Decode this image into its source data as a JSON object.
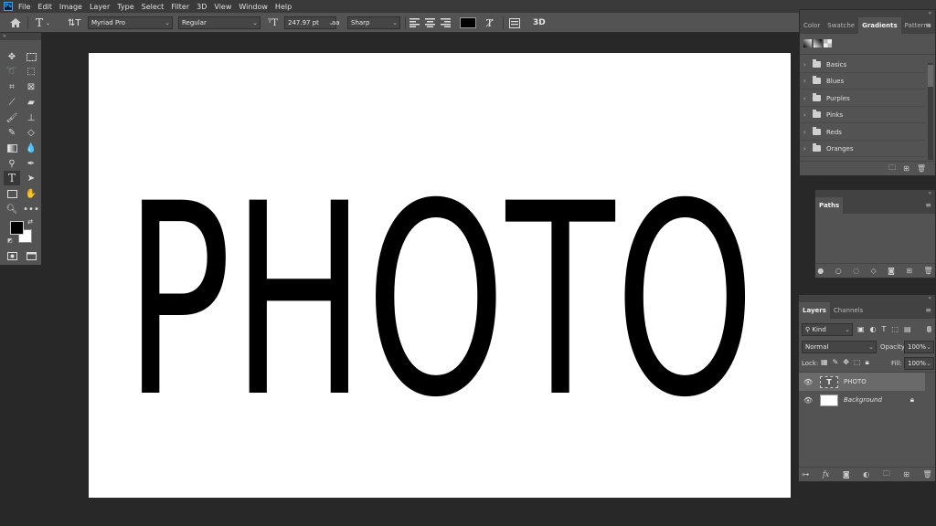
{
  "menubar": {
    "app_badge": "Ps",
    "items": [
      "File",
      "Edit",
      "Image",
      "Layer",
      "Type",
      "Select",
      "Filter",
      "3D",
      "View",
      "Window",
      "Help"
    ]
  },
  "options": {
    "font_family": "Myriad Pro",
    "font_style": "Regular",
    "font_size": "247.97 pt",
    "aa_label": "aa",
    "antialias": "Sharp",
    "threed_label": "3D",
    "text_color": "#000000"
  },
  "canvas": {
    "text": "PHOTO",
    "background": "#ffffff",
    "text_color": "#000000"
  },
  "gradients_panel": {
    "tabs": [
      "Color",
      "Swatche",
      "Gradients",
      "Patterns"
    ],
    "active_tab": "Gradients",
    "folders": [
      "Basics",
      "Blues",
      "Purples",
      "Pinks",
      "Reds",
      "Oranges"
    ]
  },
  "paths_panel": {
    "tab": "Paths"
  },
  "layers_panel": {
    "tabs": [
      "Layers",
      "Channels"
    ],
    "filter_kind": "Kind",
    "blend_mode": "Normal",
    "opacity_label": "Opacity:",
    "opacity_value": "100%",
    "lock_label": "Lock:",
    "fill_label": "Fill:",
    "fill_value": "100%",
    "layers": [
      {
        "name": "PHOTO",
        "type": "text",
        "selected": true
      },
      {
        "name": "Background",
        "type": "image",
        "selected": false
      }
    ],
    "footer_fx": "fx"
  },
  "colors": {
    "app_bg": "#282828",
    "panel_bg": "#535353",
    "accent_blue": "#31a8ff"
  }
}
